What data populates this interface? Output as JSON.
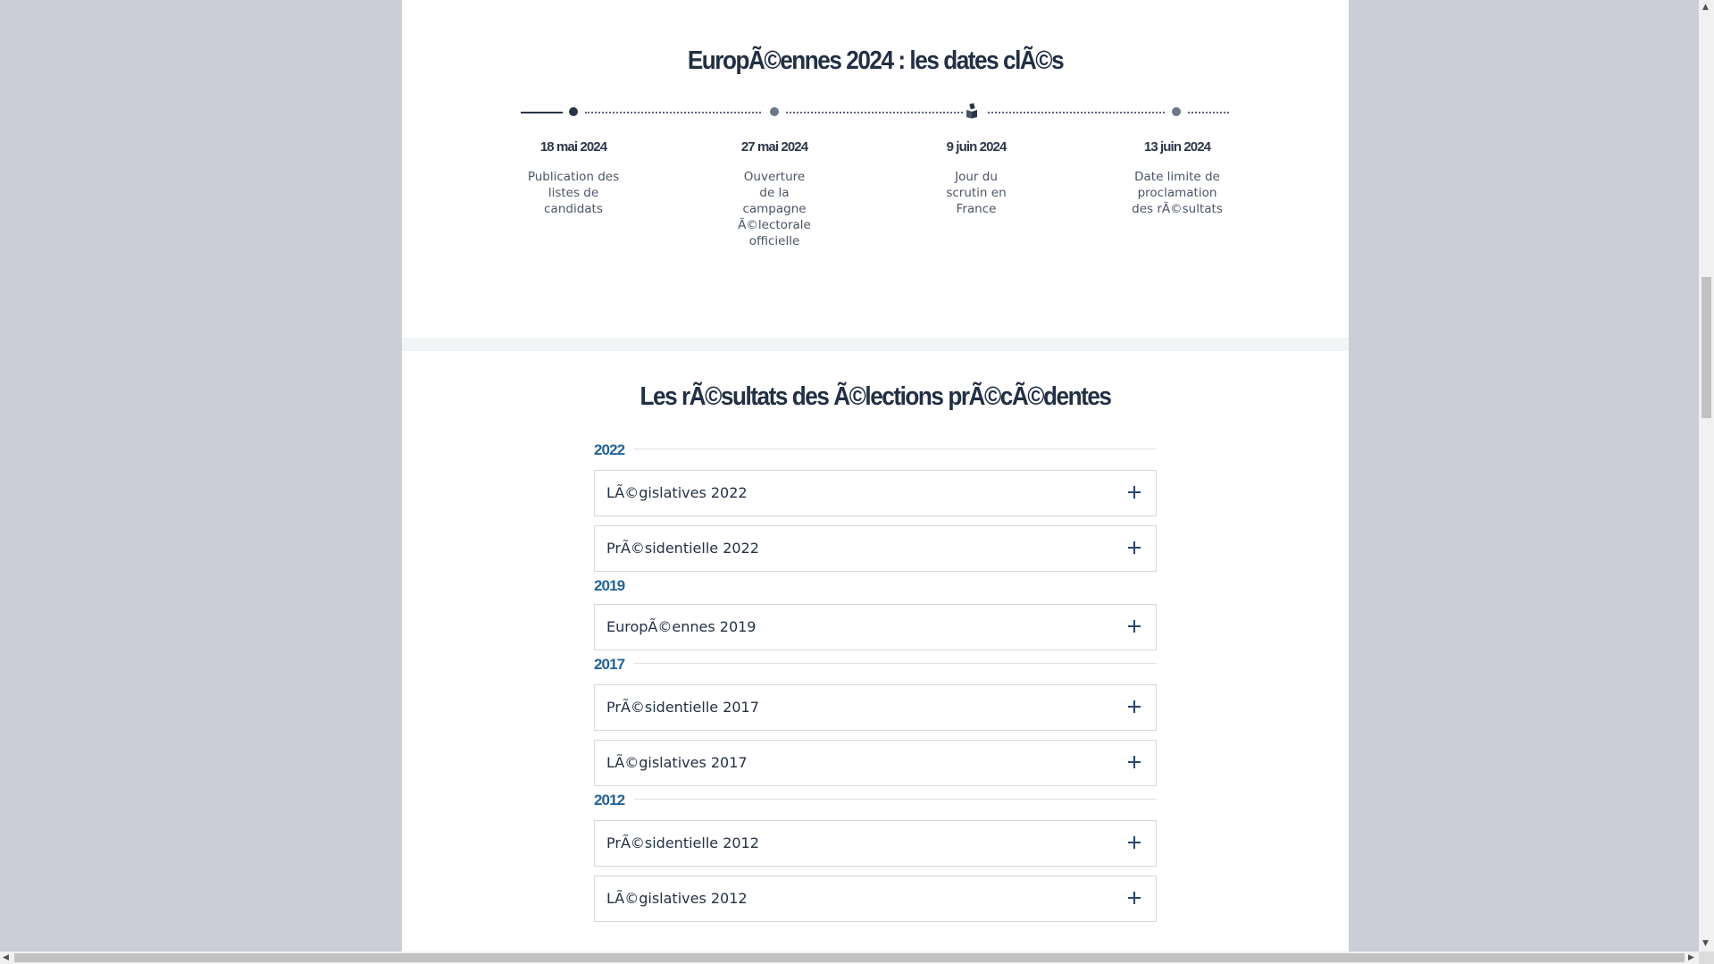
{
  "key_dates": {
    "title": "EuropÃ©ennes 2024 : les dates clÃ©s",
    "events": [
      {
        "date": "18 mai 2024",
        "description": "Publication des listes de candidats",
        "marker": "dot-dark"
      },
      {
        "date": "27 mai 2024",
        "description": "Ouverture de la campagne Ã©lectorale officielle",
        "marker": "dot-grey"
      },
      {
        "date": "9 juin 2024",
        "description": "Jour du scrutin en France",
        "marker": "ballot-box-icon"
      },
      {
        "date": "13 juin 2024",
        "description": "Date limite de proclamation des rÃ©sultats",
        "marker": "dot-grey"
      }
    ]
  },
  "results": {
    "title": "Les rÃ©sultats des Ã©lections prÃ©cÃ©dentes",
    "groups": [
      {
        "year": "2022",
        "items": [
          "LÃ©gislatives 2022",
          "PrÃ©sidentielle 2022"
        ]
      },
      {
        "year": "2019",
        "items": [
          "EuropÃ©ennes 2019"
        ]
      },
      {
        "year": "2017",
        "items": [
          "PrÃ©sidentielle 2017",
          "LÃ©gislatives 2017"
        ]
      },
      {
        "year": "2012",
        "items": [
          "PrÃ©sidentielle 2012",
          "LÃ©gislatives 2012"
        ]
      }
    ],
    "expand_icon": "plus-icon"
  },
  "colors": {
    "page_background": "#cbced7",
    "content_background": "#ffffff",
    "heading": "#222f44",
    "year_accent": "#246397",
    "timeline_dark": "#2a3446",
    "timeline_grey": "#6d7588"
  }
}
